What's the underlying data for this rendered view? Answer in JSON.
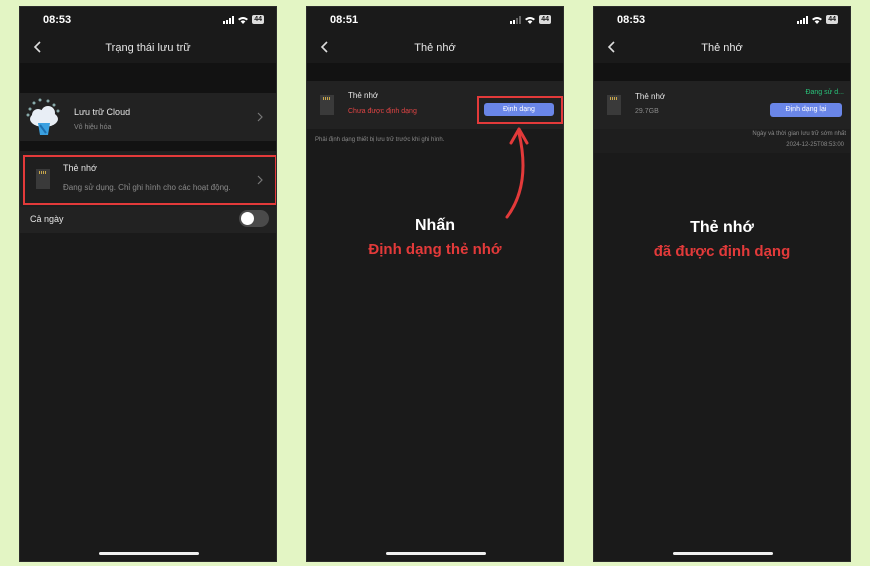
{
  "colors": {
    "page_bg": "#e3f5c4",
    "phone_bg": "#1a1a1a",
    "accent_red": "#e33a3a",
    "button_blue": "#6a86e8",
    "status_green": "#29c27a"
  },
  "phone1": {
    "time": "08:53",
    "battery": "44",
    "title": "Trạng thái lưu trữ",
    "cloud": {
      "label": "Lưu trữ Cloud",
      "sub": "Vô hiệu hóa"
    },
    "sdcard": {
      "label": "Thẻ nhớ",
      "sub": "Đang sử dụng. Chỉ ghi hình cho các hoạt động."
    },
    "allday": {
      "label": "Cả ngày",
      "on": false
    }
  },
  "phone2": {
    "time": "08:51",
    "battery": "44",
    "title": "Thẻ nhớ",
    "sdcard": {
      "label": "Thẻ nhớ",
      "status": "Chưa được định dạng",
      "button": "Định dạng"
    },
    "note": "Phải định dạng thiết bị lưu trữ trước khi ghi hình.",
    "caption_line1": "Nhấn",
    "caption_line2": "Định dạng thẻ nhớ"
  },
  "phone3": {
    "time": "08:53",
    "battery": "44",
    "title": "Thẻ nhớ",
    "sdcard": {
      "label": "Thẻ nhớ",
      "size": "29.7GB",
      "status": "Đang sử d...",
      "button": "Định dạng lại"
    },
    "earliest_label": "Ngày và thời gian lưu trữ sớm nhất",
    "earliest_value": "2024-12-25T08:53:00",
    "caption_line1": "Thẻ nhớ",
    "caption_line2": "đã được định dạng"
  }
}
